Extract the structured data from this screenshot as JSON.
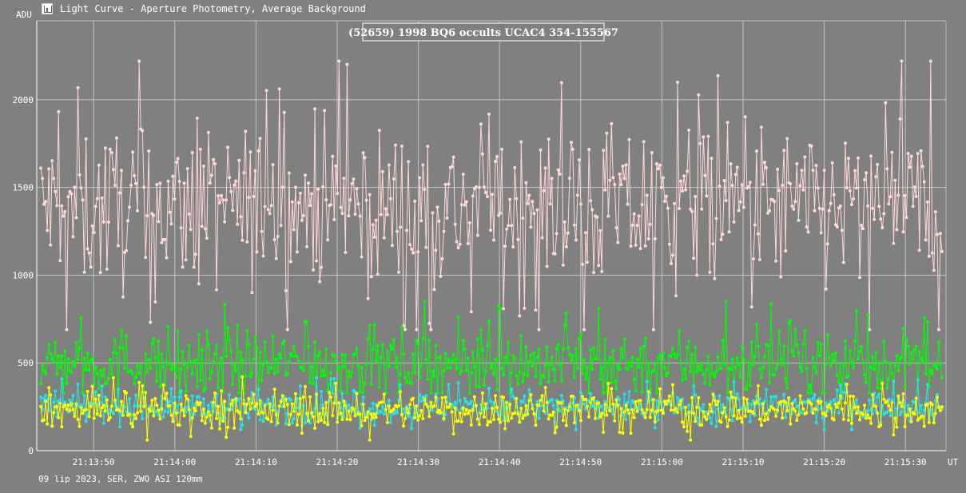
{
  "window": {
    "title": "Light Curve - Aperture Photometry, Average Background"
  },
  "footer": {
    "info": "09 lip 2023, SER, ZWO ASI 120mm"
  },
  "chart_data": {
    "type": "line",
    "title": "(52659) 1998 BQ6 occults UCAC4 354-155567",
    "ylabel": "ADU",
    "xlabel": "UT",
    "ylim": [
      0,
      2450
    ],
    "yticks": [
      0,
      500,
      1000,
      1500,
      2000
    ],
    "xlim_seconds": [
      45.0,
      105.0
    ],
    "xticks": [
      {
        "t": 50,
        "label": "21:13:50"
      },
      {
        "t": 60,
        "label": "21:14:00"
      },
      {
        "t": 70,
        "label": "21:14:10"
      },
      {
        "t": 80,
        "label": "21:14:20"
      },
      {
        "t": 90,
        "label": "21:14:30"
      },
      {
        "t": 100,
        "label": "21:14:40"
      },
      {
        "t": 110,
        "label": "21:14:50"
      },
      {
        "t": 120,
        "label": "21:15:00"
      },
      {
        "t": 130,
        "label": "21:15:10"
      },
      {
        "t": 140,
        "label": "21:15:20"
      },
      {
        "t": 150,
        "label": "21:15:30"
      }
    ],
    "grid": true,
    "series": [
      {
        "color": "#ffd7d7",
        "mean": 1380,
        "spread": 230,
        "max": 2220,
        "min": 690
      },
      {
        "color": "#00ff00",
        "mean": 500,
        "spread": 95,
        "max": 880,
        "min": 330
      },
      {
        "color": "#22e6e6",
        "mean": 250,
        "spread": 45,
        "max": 420,
        "min": 120
      },
      {
        "color": "#ffff00",
        "mean": 235,
        "spread": 55,
        "max": 420,
        "min": 60
      }
    ],
    "colors": {
      "background": "#808080",
      "grid": "#c0c0c0",
      "axis": "#ffffff"
    }
  }
}
